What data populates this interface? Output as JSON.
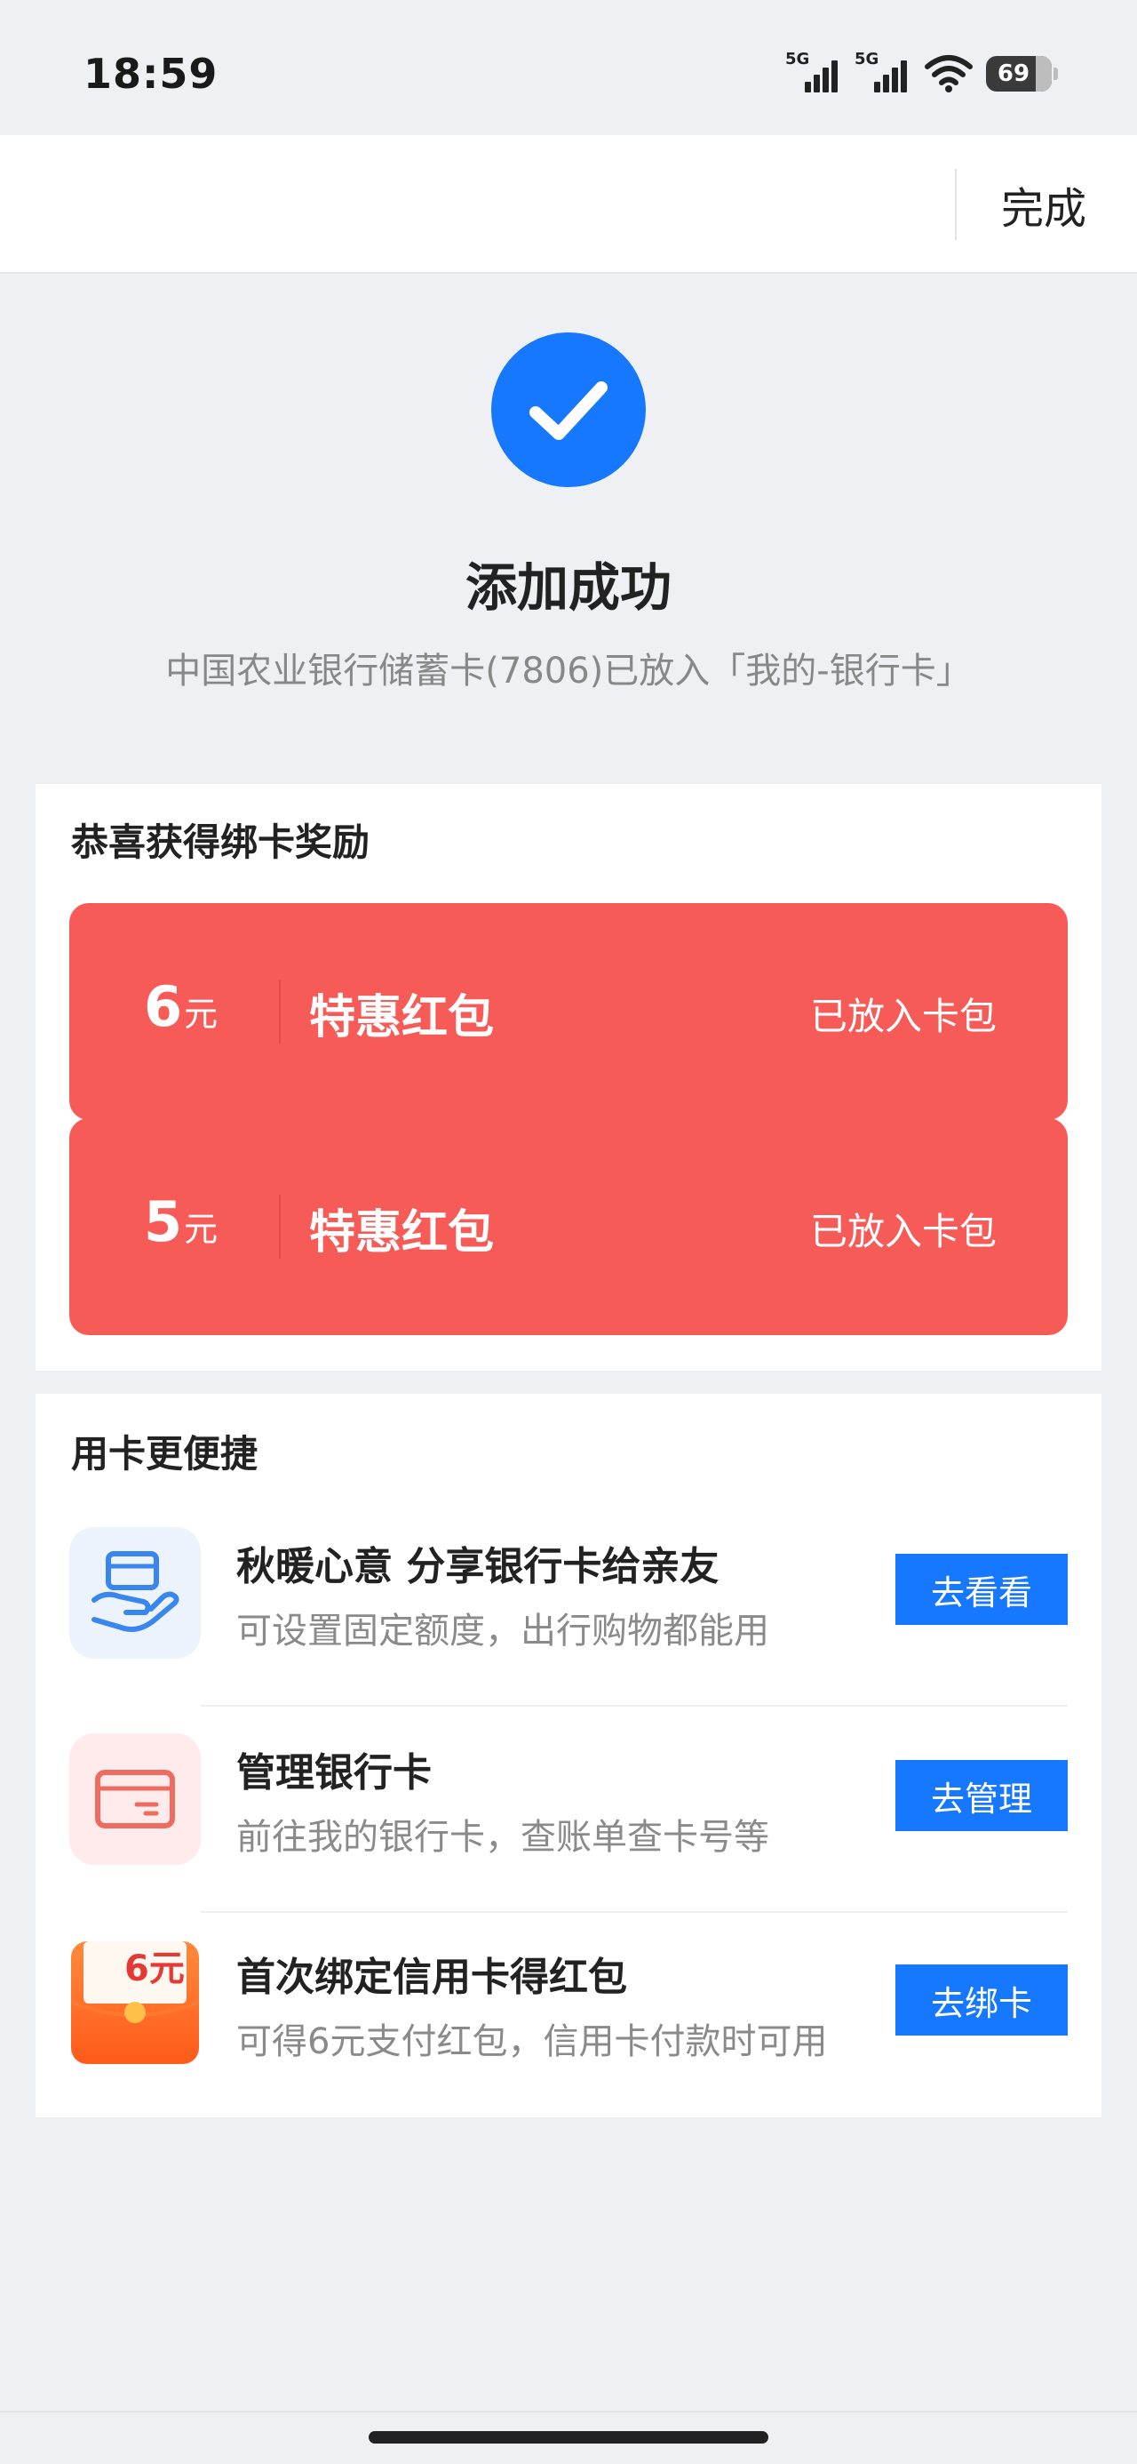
{
  "status_bar": {
    "time": "18:59",
    "signal_1_label": "5G",
    "signal_2_label": "5G",
    "battery_level": "69",
    "icons": [
      "signal-5g-icon",
      "signal-5g-icon",
      "wifi-icon",
      "battery-icon"
    ]
  },
  "nav": {
    "done_label": "完成"
  },
  "success": {
    "icon": "check-icon",
    "title": "添加成功",
    "description": "中国农业银行储蓄卡(7806)已放入「我的-银行卡」"
  },
  "reward": {
    "title": "恭喜获得绑卡奖励",
    "items": [
      {
        "amount": "6",
        "unit": "元",
        "name": "特惠红包",
        "status": "已放入卡包"
      },
      {
        "amount": "5",
        "unit": "元",
        "name": "特惠红包",
        "status": "已放入卡包"
      }
    ]
  },
  "shortcuts": {
    "title": "用卡更便捷",
    "items": [
      {
        "icon": "share-card-icon",
        "title": "秋暖心意 分享银行卡给亲友",
        "subtitle": "可设置固定额度，出行购物都能用",
        "button": "去看看"
      },
      {
        "icon": "bank-card-icon",
        "title": "管理银行卡",
        "subtitle": "前往我的银行卡，查账单查卡号等",
        "button": "去管理"
      },
      {
        "icon": "red-packet-icon",
        "icon_text": "6元",
        "title": "首次绑定信用卡得红包",
        "subtitle": "可得6元支付红包，信用卡付款时可用",
        "button": "去绑卡"
      }
    ]
  },
  "colors": {
    "accent": "#1677ff",
    "red_packet": "#f65b57",
    "background": "#eef0f4"
  }
}
